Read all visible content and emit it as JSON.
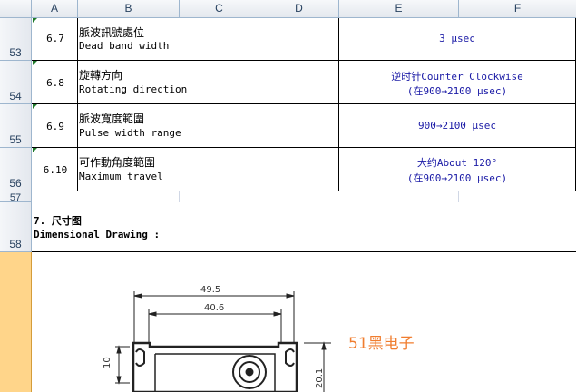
{
  "columns": [
    "A",
    "B",
    "C",
    "D",
    "E",
    "F"
  ],
  "rows": [
    {
      "num": "53",
      "item": "6.7",
      "zh": "脈波訊號處位",
      "en": "Dead band width",
      "spec1": "3 μsec",
      "spec2": ""
    },
    {
      "num": "54",
      "item": "6.8",
      "zh": "旋轉方向",
      "en": "Rotating direction",
      "spec1": "逆时针Counter Clockwise",
      "spec2": "(在900→2100 μsec)"
    },
    {
      "num": "55",
      "item": "6.9",
      "zh": "脈波寬度範圍",
      "en": "Pulse width range",
      "spec1": "900→2100 μsec",
      "spec2": ""
    },
    {
      "num": "56",
      "item": "6.10",
      "zh": "可作動角度範圍",
      "en": "Maximum travel",
      "spec1": "大约About 120°",
      "spec2": "(在900→2100 μsec)"
    }
  ],
  "row57": "57",
  "section": {
    "num": "58",
    "title_zh": "7. 尺寸图",
    "title_en": "Dimensional Drawing :"
  },
  "drawing": {
    "dim_outer": "49.5",
    "dim_inner": "40.6",
    "dim_left": "10",
    "dim_right": "20.1"
  },
  "watermark": "51黑电子",
  "colors": {
    "spec_text": "#1a1aa6",
    "header_bg": "#e4e8ee",
    "selected_row": "#ffd58a",
    "watermark": "#f07d2f"
  }
}
